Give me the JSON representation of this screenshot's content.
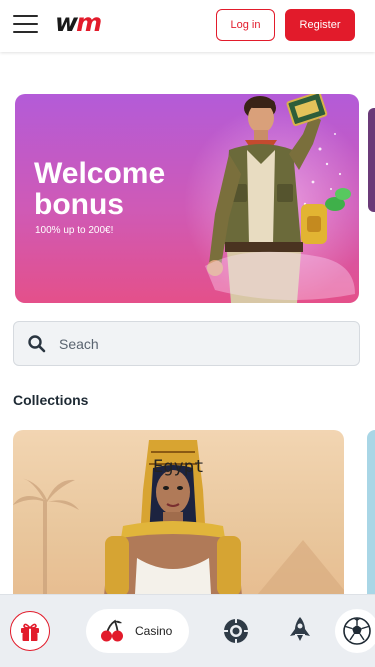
{
  "header": {
    "logo_w": "w",
    "logo_m": "m",
    "login_label": "Log in",
    "register_label": "Register"
  },
  "banner": {
    "title_line1": "Welcome",
    "title_line2": "bonus",
    "subtitle": "100% up to 200€!"
  },
  "search": {
    "placeholder": "Seach"
  },
  "collections": {
    "title": "Collections",
    "card_label": "Egypt"
  },
  "bottom_nav": {
    "casino_label": "Casino"
  },
  "colors": {
    "brand_red": "#e21b2b",
    "banner_top": "#b35bd8",
    "banner_bottom": "#e4508a"
  },
  "icons": [
    "hamburger-icon",
    "search-icon",
    "gift-icon",
    "cherry-icon",
    "live-casino-chip-icon",
    "rocket-icon",
    "football-icon"
  ]
}
